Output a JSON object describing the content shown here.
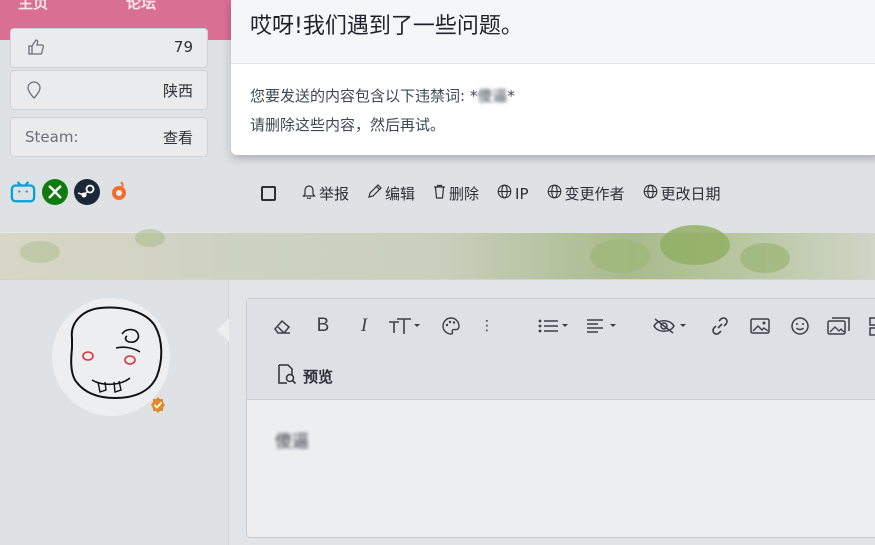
{
  "nav": {
    "item1": "主页",
    "item2": "论坛"
  },
  "profile": {
    "likes_value": "79",
    "location_value": "陕西",
    "steam_label": "Steam:",
    "steam_action": "查看",
    "badges": [
      "bilibili-icon",
      "xbox-icon",
      "steam-icon",
      "origin-icon"
    ]
  },
  "actions": {
    "report": "举报",
    "edit": "编辑",
    "delete": "删除",
    "ip": "IP",
    "change_author": "变更作者",
    "change_date": "更改日期"
  },
  "editor": {
    "preview_label": "预览",
    "content": "傻逼"
  },
  "modal": {
    "title": "哎呀!我们遇到了一些问题。",
    "message_prefix": "您要发送的内容包含以下违禁词: *",
    "blocked_word": "傻逼",
    "message_suffix": "*",
    "message_line2": "请删除这些内容，然后再试。"
  },
  "colors": {
    "pink_nav": "#d95b86",
    "verified_badge": "#e08a2c",
    "bilibili": "#00a1d6",
    "xbox": "#107c10",
    "steam": "#1b2838",
    "origin": "#f56c2d"
  }
}
